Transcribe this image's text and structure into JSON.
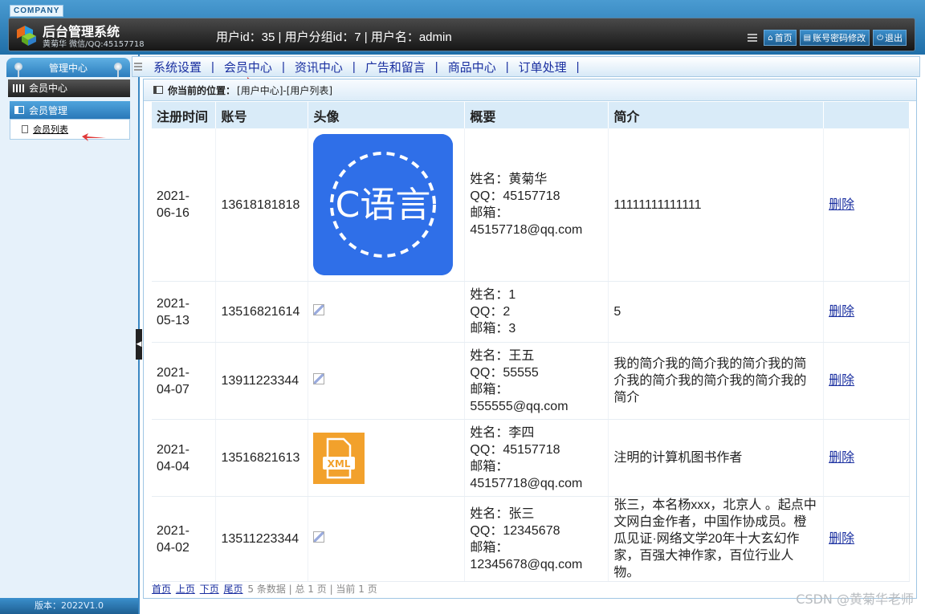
{
  "header": {
    "company": "COMPANY",
    "title": "后台管理系统",
    "subtitle": "黄菊华 微信/QQ:45157718",
    "userinfo": "用户id：35 | 用户分组id：7 | 用户名：admin",
    "buttons": {
      "home": "首页",
      "password": "账号密码修改",
      "logout": "退出"
    }
  },
  "sidebar": {
    "head": "管理中心",
    "category": "会员中心",
    "group": "会员管理",
    "item": "会员列表",
    "version": "版本：2022V1.0"
  },
  "nav": [
    "系统设置",
    "会员中心",
    "资讯中心",
    "广告和留言",
    "商品中心",
    "订单处理"
  ],
  "breadcrumb": {
    "label": "你当前的位置：",
    "path": "[用户中心]-[用户列表]"
  },
  "table": {
    "headers": [
      "注册时间",
      "账号",
      "头像",
      "概要",
      "简介",
      ""
    ],
    "rows": [
      {
        "date1": "2021-",
        "date2": "06-16",
        "account": "13618181818",
        "avatar_text": "C语言",
        "name": "姓名：黄菊华",
        "qq": "QQ：45157718",
        "mail_label": "邮箱：",
        "mail": "45157718@qq.com",
        "intro": "11111111111111",
        "action": "删除"
      },
      {
        "date1": "2021-",
        "date2": "05-13",
        "account": "13516821614",
        "name": "姓名：1",
        "qq": "QQ：2",
        "mail_label": "邮箱：3",
        "mail": "",
        "intro": "5",
        "action": "删除"
      },
      {
        "date1": "2021-",
        "date2": "04-07",
        "account": "13911223344",
        "name": "姓名：王五",
        "qq": "QQ：55555",
        "mail_label": "邮箱：",
        "mail": "555555@qq.com",
        "intro": "我的简介我的简介我的简介我的简介我的简介我的简介我的简介我的简介",
        "action": "删除"
      },
      {
        "date1": "2021-",
        "date2": "04-04",
        "account": "13516821613",
        "avatar_text": "XML",
        "name": "姓名：李四",
        "qq": "QQ：45157718",
        "mail_label": "邮箱：",
        "mail": "45157718@qq.com",
        "intro": "注明的计算机图书作者",
        "action": "删除"
      },
      {
        "date1": "2021-",
        "date2": "04-02",
        "account": "13511223344",
        "name": "姓名：张三",
        "qq": "QQ：12345678",
        "mail_label": "邮箱：",
        "mail": "12345678@qq.com",
        "intro": "张三，本名杨xxx，北京人 。起点中文网白金作者，中国作协成员。橙瓜见证·网络文学20年十大玄幻作家，百强大神作家，百位行业人物。",
        "action": "删除"
      }
    ]
  },
  "pager": {
    "first": "首页",
    "prev": "上页",
    "next": "下页",
    "last": "尾页",
    "summary": "5 条数据 | 总 1 页 | 当前 1 页"
  },
  "watermark": "CSDN @黄菊华老师"
}
